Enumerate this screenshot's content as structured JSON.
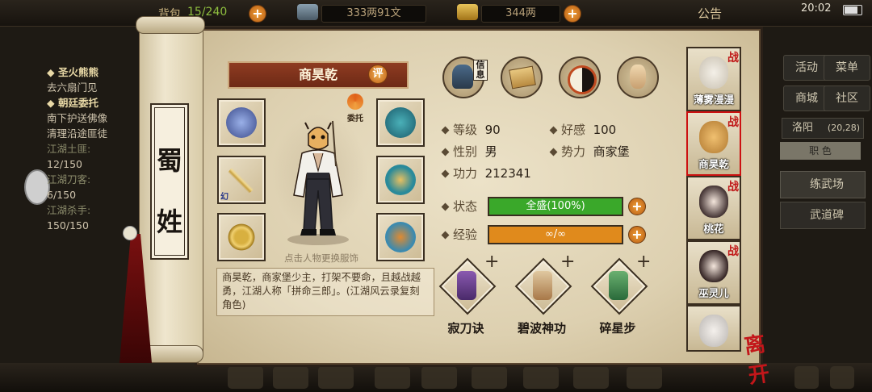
{
  "status_bar": {
    "time": "20:02"
  },
  "top_bar": {
    "capacity_label": "背包",
    "capacity": "15/240",
    "silver": "333两91文",
    "gold": "344两",
    "notice": "公告",
    "plus": "+"
  },
  "quest_panel": {
    "lines": [
      {
        "text": "◆ 圣火熊熊",
        "style": "title"
      },
      {
        "text": "去六扇门见",
        "style": "normal"
      },
      {
        "text": "◆ 朝廷委托",
        "style": "title"
      },
      {
        "text": "南下护送佛像",
        "style": "normal"
      },
      {
        "text": "清理沿途匪徒",
        "style": "normal"
      },
      {
        "text": "江湖土匪:",
        "style": "faded"
      },
      {
        "text": "12/150",
        "style": "normal"
      },
      {
        "text": "江湖刀客:",
        "style": "faded"
      },
      {
        "text": "6/150",
        "style": "normal"
      },
      {
        "text": "江湖杀手:",
        "style": "faded"
      },
      {
        "text": "150/150",
        "style": "normal"
      }
    ]
  },
  "right_menu": {
    "buttons": [
      "活动",
      "菜单",
      "商城",
      "社区"
    ],
    "location": "洛阳",
    "coords": "(20,28)",
    "tab": "职 色",
    "list": [
      "练武场",
      "武道碑"
    ]
  },
  "scroll": {
    "chars": [
      "蜀",
      "姓"
    ]
  },
  "character": {
    "name": "商昊乾",
    "ping_label": "评",
    "weituo_label": "委托",
    "hint": "点击人物更换服饰",
    "bio": "商昊乾，商家堡少主，打架不要命，且越战越勇，江湖人称「拼命三郎」。(江湖风云录复刻角色)"
  },
  "top_icons": [
    {
      "name": "info",
      "label": "信息"
    },
    {
      "name": "manual",
      "label": ""
    },
    {
      "name": "taichi",
      "label": ""
    },
    {
      "name": "training",
      "label": ""
    }
  ],
  "stats": {
    "level_label": "等级",
    "level": "90",
    "favor_label": "好感",
    "favor": "100",
    "gender_label": "性别",
    "gender": "男",
    "faction_label": "势力",
    "faction": "商家堡",
    "power_label": "功力",
    "power": "212341"
  },
  "status": {
    "label": "状态",
    "text": "全盛(100%)",
    "fill_fraction": 1.0,
    "color": "#3aa82a"
  },
  "exp": {
    "label": "经验",
    "text": "∞/∞",
    "fill_fraction": 1.0,
    "color": "#e08a1c"
  },
  "skills": [
    {
      "name": "寂刀诀",
      "plus": "+"
    },
    {
      "name": "碧波神功",
      "plus": "+"
    },
    {
      "name": "碎星步",
      "plus": "+"
    }
  ],
  "equipment_slots": {
    "left_badge": "幻"
  },
  "party": [
    {
      "name": "薄雾漫漫",
      "badge": "战"
    },
    {
      "name": "商昊乾",
      "badge": "战"
    },
    {
      "name": "桃花",
      "badge": "战"
    },
    {
      "name": "巫灵儿",
      "badge": "战"
    },
    {
      "name": "",
      "badge": ""
    }
  ],
  "leave_label": "离开",
  "colors": {
    "banner": "#8e3b21",
    "accent_plus": "#e08a1c",
    "zhan_red": "#c01818"
  }
}
